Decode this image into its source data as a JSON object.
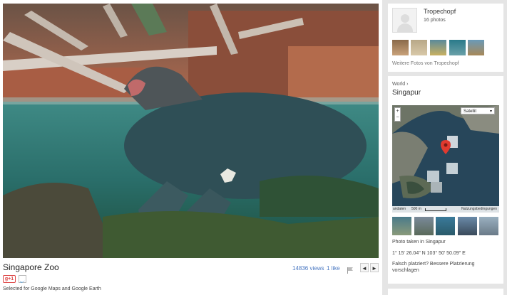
{
  "photo": {
    "title": "Singapore Zoo",
    "views": "14836 views",
    "likes": "1 like",
    "prev_label": "◄",
    "next_label": "►",
    "gplus_label": "g+1",
    "selected_note": "Selected for Google Maps and Google Earth"
  },
  "user": {
    "name": "Tropechopf",
    "photo_count": "16 photos",
    "more_photos_prefix": "Weitere Fotos von ",
    "more_photos_name": "Tropechopf"
  },
  "location": {
    "breadcrumb": "World ›",
    "title": "Singapur",
    "map_type": "Satellit",
    "zoom_in": "+",
    "zoom_out": "−",
    "map_left": "andaten",
    "scale": "500 m",
    "terms": "Nutzungsbedingungen",
    "taken_in": "Photo taken in Singapur",
    "coords": "1° 15' 26.04\" N  103° 50' 50.09\" E",
    "misplaced": "Falsch platziert? Bessere Platzierung vorschlagen"
  },
  "colors": {
    "link": "#4a78c2",
    "marker": "#e03a2f",
    "water": "#2a6e6a"
  }
}
